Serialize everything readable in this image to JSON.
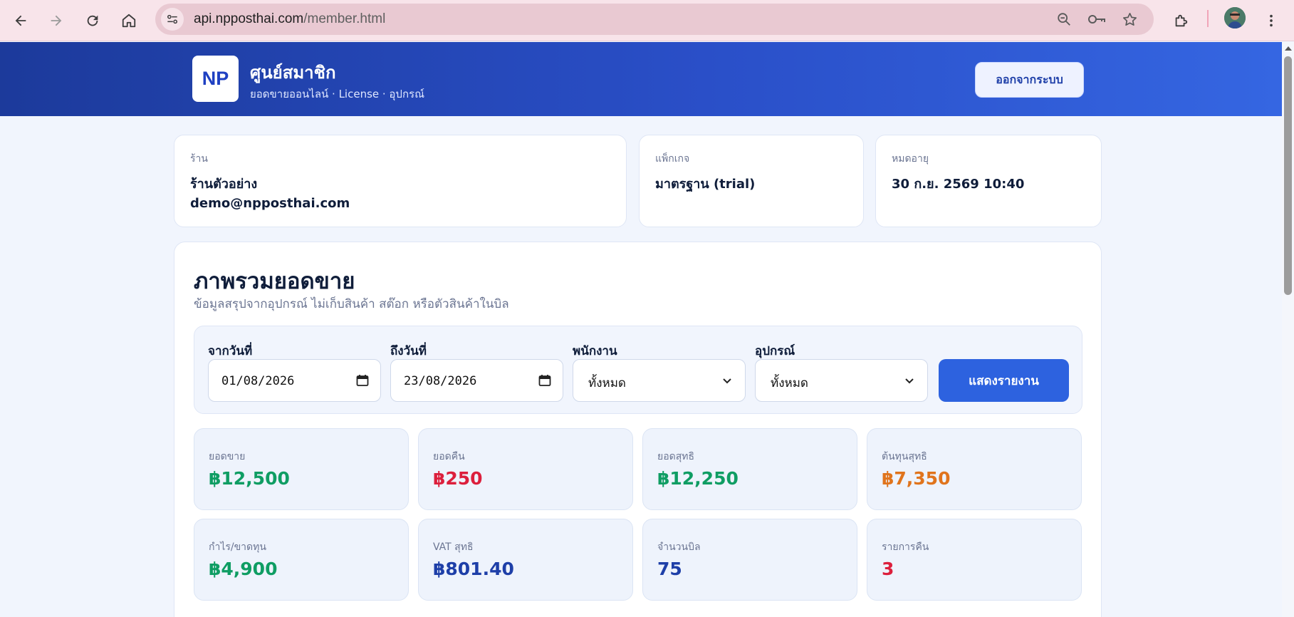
{
  "browser": {
    "url_host": "api.npposthai.com",
    "url_path": "/member.html"
  },
  "header": {
    "logo_text": "NP",
    "title": "ศูนย์สมาชิก",
    "subtitle": "ยอดขายออนไลน์ · License · อุปกรณ์",
    "logout_label": "ออกจากระบบ"
  },
  "info_cards": {
    "shop": {
      "label": "ร้าน",
      "name": "ร้านตัวอย่าง",
      "email": "demo@npposthai.com"
    },
    "package": {
      "label": "แพ็กเกจ",
      "value": "มาตรฐาน (trial)"
    },
    "expiry": {
      "label": "หมดอายุ",
      "value": "30 ก.ย. 2569 10:40"
    }
  },
  "overview": {
    "title": "ภาพรวมยอดขาย",
    "subtitle": "ข้อมูลสรุปจากอุปกรณ์ ไม่เก็บสินค้า สต๊อก หรือตัวสินค้าในบิล",
    "filters": {
      "from_label": "จากวันที่",
      "from_value": "01/08/2026",
      "to_label": "ถึงวันที่",
      "to_value": "23/08/2026",
      "employee_label": "พนักงาน",
      "employee_value": "ทั้งหมด",
      "device_label": "อุปกรณ์",
      "device_value": "ทั้งหมด",
      "submit_label": "แสดงรายงาน"
    },
    "stats": [
      {
        "label": "ยอดขาย",
        "value": "฿12,500",
        "color": "#0f9d63"
      },
      {
        "label": "ยอดคืน",
        "value": "฿250",
        "color": "#dc1f3c"
      },
      {
        "label": "ยอดสุทธิ",
        "value": "฿12,250",
        "color": "#0f9d63"
      },
      {
        "label": "ต้นทุนสุทธิ",
        "value": "฿7,350",
        "color": "#e0741c"
      },
      {
        "label": "กำไร/ขาดทุน",
        "value": "฿4,900",
        "color": "#0f9d63"
      },
      {
        "label": "VAT สุทธิ",
        "value": "฿801.40",
        "color": "#1e3fa8"
      },
      {
        "label": "จำนวนบิล",
        "value": "75",
        "color": "#1e3fa8"
      },
      {
        "label": "รายการคืน",
        "value": "3",
        "color": "#dc1f3c"
      }
    ]
  }
}
